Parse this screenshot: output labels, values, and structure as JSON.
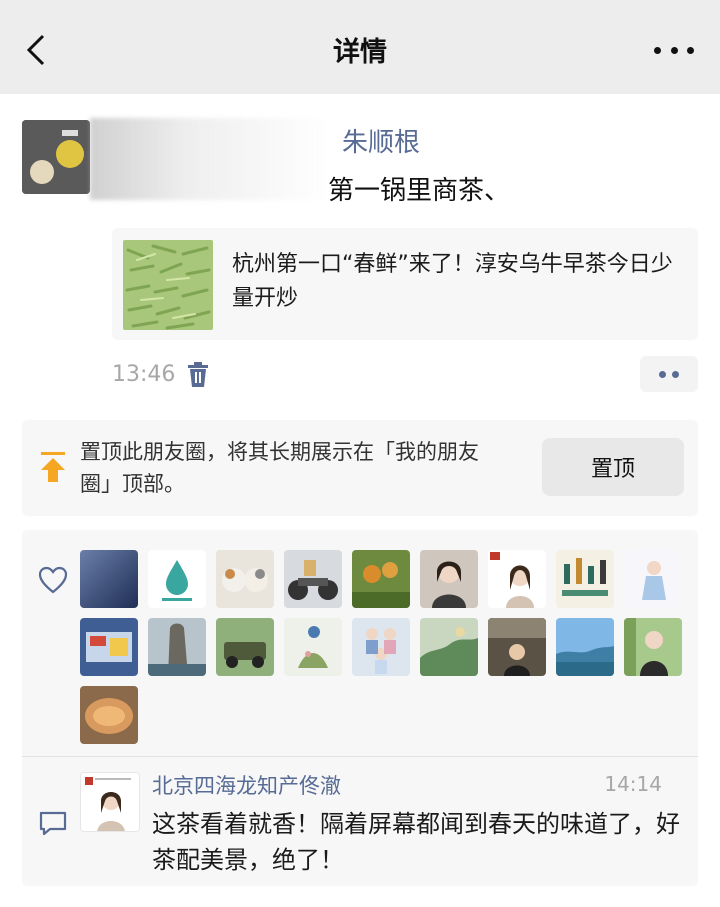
{
  "header": {
    "title": "详情",
    "back_icon": "chevron-left-icon",
    "more_icon": "more-dots-icon"
  },
  "post": {
    "author": "朱顺根",
    "text": "第一锅里商茶、",
    "share": {
      "title": "杭州第一口“春鲜”来了！淳安乌牛早茶今日少量开炒"
    },
    "time": "13:46"
  },
  "pin": {
    "text": "置顶此朋友圈，将其长期展示在「我的朋友圈」顶部。",
    "button": "置顶"
  },
  "likes": {
    "count": 19
  },
  "comment": {
    "author": "北京四海龙知产佟澈",
    "time": "14:14",
    "text": "这茶看着就香！隔着屏幕都闻到春天的味道了，好茶配美景，绝了！"
  },
  "colors": {
    "link": "#576b95",
    "header_bg": "#ededed",
    "card_bg": "#f7f7f7",
    "pin_accent": "#f5a623"
  }
}
